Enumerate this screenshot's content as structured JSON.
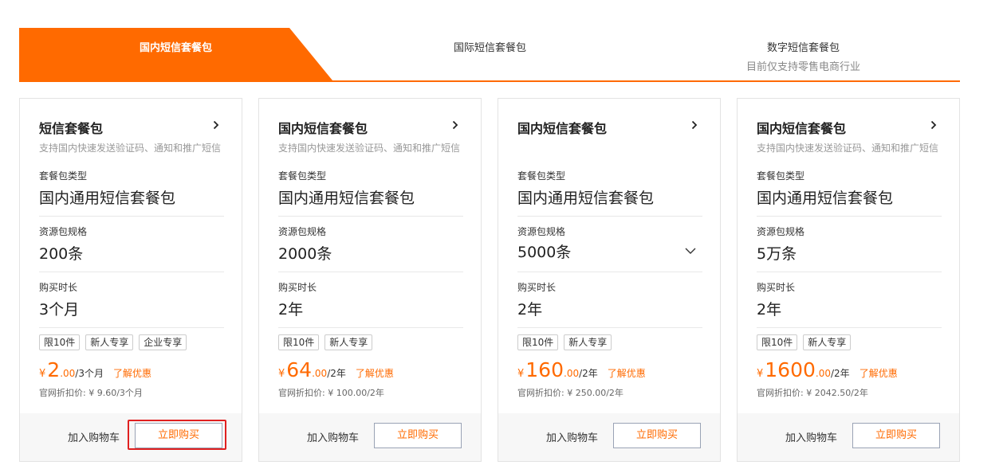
{
  "tabs": [
    {
      "label": "国内短信套餐包",
      "sub": ""
    },
    {
      "label": "国际短信套餐包",
      "sub": ""
    },
    {
      "label": "数字短信套餐包",
      "sub": "目前仅支持零售电商行业"
    }
  ],
  "colors": {
    "accent": "#ff6a00",
    "highlight": "#e02020"
  },
  "labels": {
    "package_type": "套餐包类型",
    "spec": "资源包规格",
    "duration": "购买时长",
    "orig_prefix": "官网折扣价: ",
    "currency": "¥",
    "promo": "了解优惠",
    "add_cart": "加入购物车",
    "buy_now": "立即购买"
  },
  "cards": [
    {
      "title": "短信套餐包",
      "desc": "支持国内快速发送验证码、通知和推广短信",
      "package_type": "国内通用短信套餐包",
      "spec": "200条",
      "duration": "3个月",
      "badges": [
        "限10件",
        "新人专享",
        "企业专享"
      ],
      "price_int": "2",
      "price_dec": ".00",
      "price_unit": "/3个月",
      "orig": "¥ 9.60/3个月",
      "has_dropdown": false,
      "highlighted": true
    },
    {
      "title": "国内短信套餐包",
      "desc": "支持国内快速发送验证码、通知和推广短信",
      "package_type": "国内通用短信套餐包",
      "spec": "2000条",
      "duration": "2年",
      "badges": [
        "限10件",
        "新人专享"
      ],
      "price_int": "64",
      "price_dec": ".00",
      "price_unit": "/2年",
      "orig": "¥ 100.00/2年",
      "has_dropdown": false,
      "highlighted": false
    },
    {
      "title": "国内短信套餐包",
      "desc": "",
      "package_type": "国内通用短信套餐包",
      "spec": "5000条",
      "duration": "2年",
      "badges": [
        "限10件",
        "新人专享"
      ],
      "price_int": "160",
      "price_dec": ".00",
      "price_unit": "/2年",
      "orig": "¥ 250.00/2年",
      "has_dropdown": true,
      "highlighted": false
    },
    {
      "title": "国内短信套餐包",
      "desc": "支持国内快速发送验证码、通知和推广短信",
      "package_type": "国内通用短信套餐包",
      "spec": "5万条",
      "duration": "2年",
      "badges": [
        "限10件",
        "新人专享"
      ],
      "price_int": "1600",
      "price_dec": ".00",
      "price_unit": "/2年",
      "orig": "¥ 2042.50/2年",
      "has_dropdown": false,
      "highlighted": false
    }
  ]
}
